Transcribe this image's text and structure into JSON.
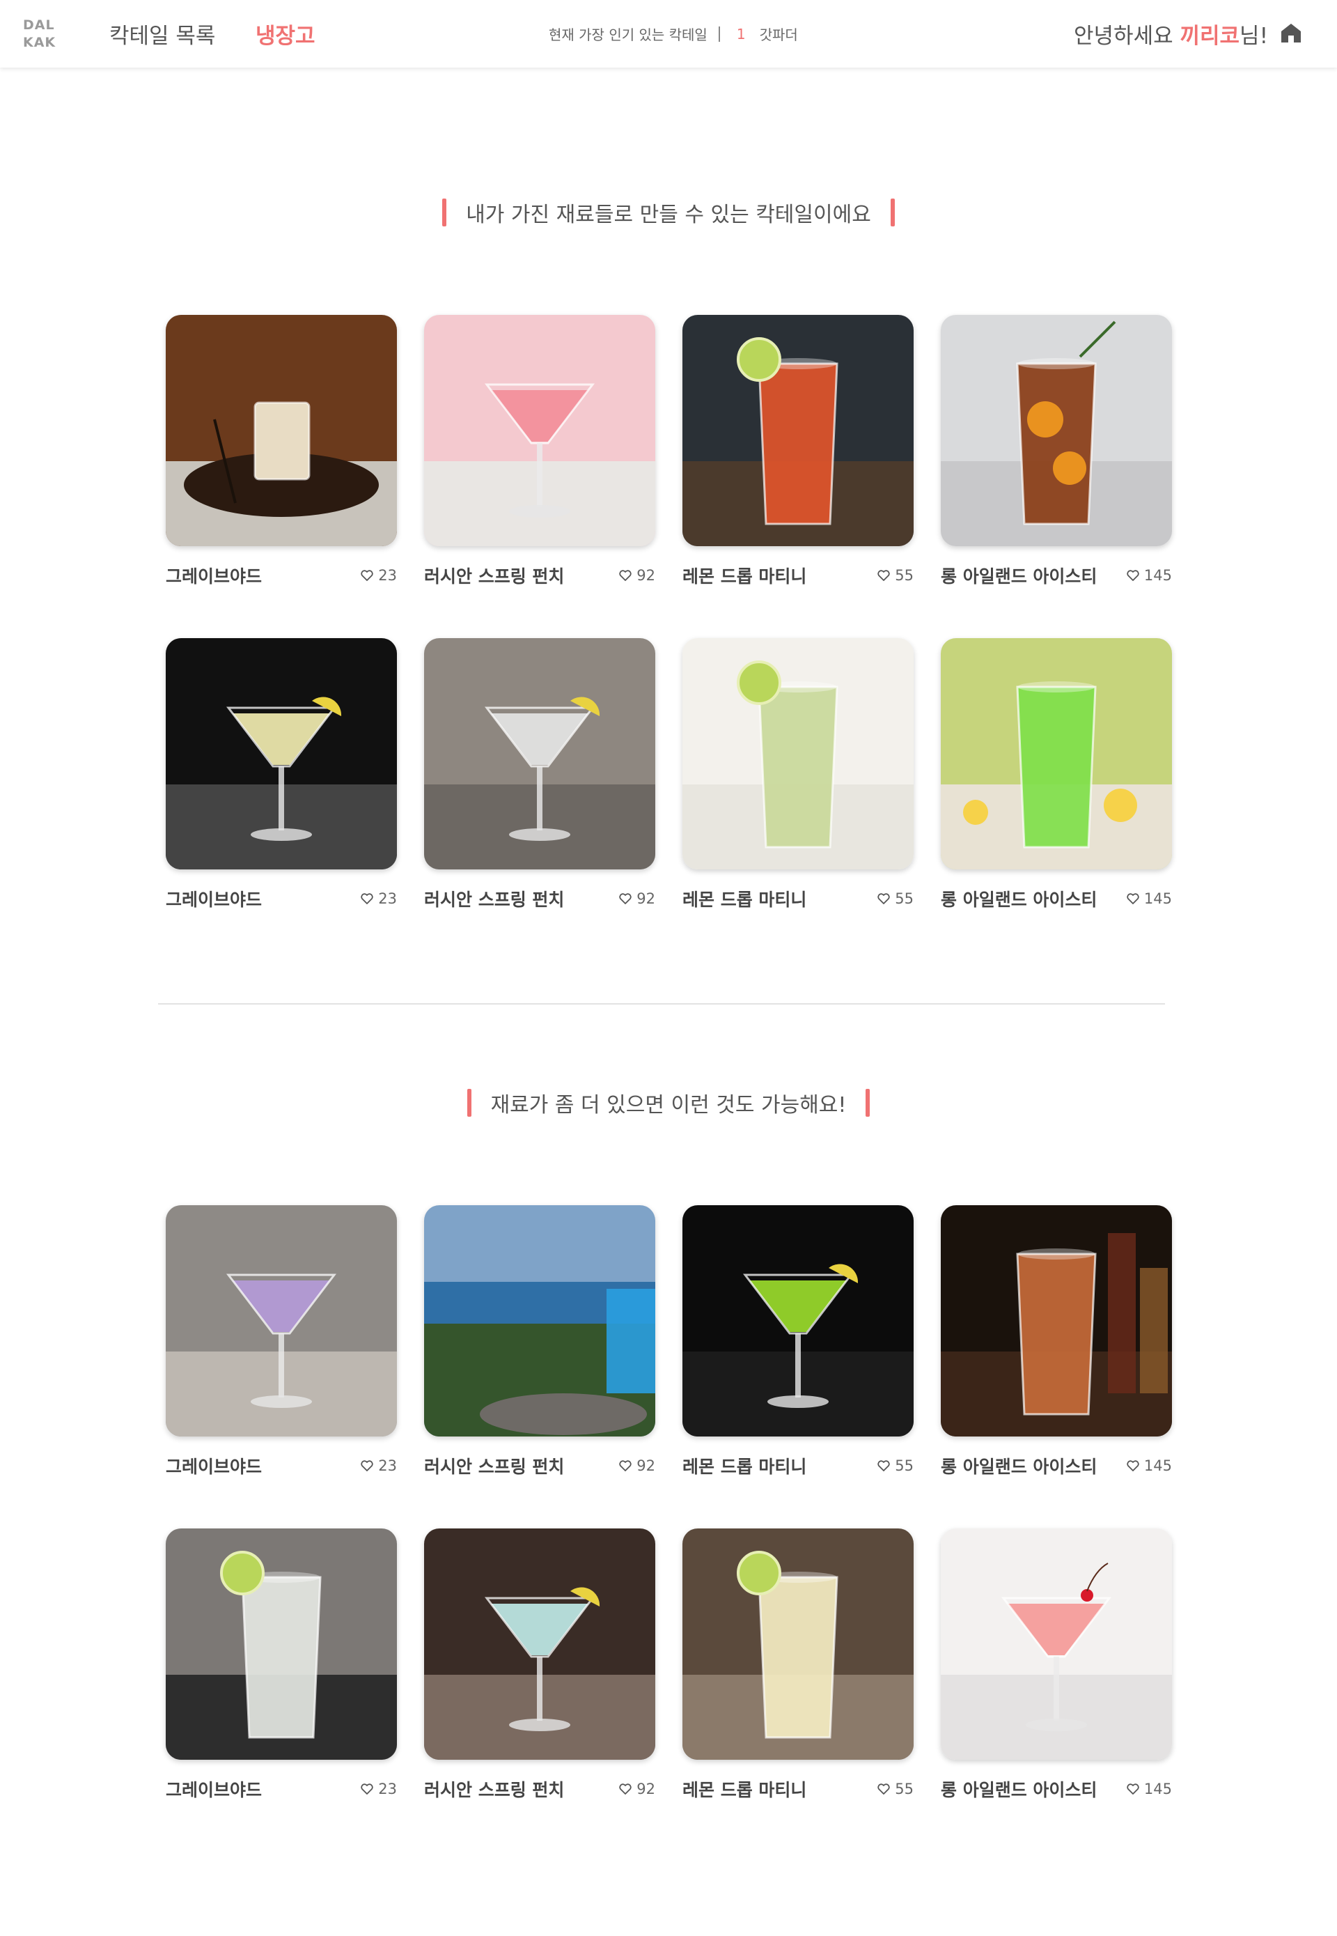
{
  "header": {
    "logo_line1": "DAL",
    "logo_line2": "KAK",
    "nav_cocktail_list": "칵테일 목록",
    "nav_fridge": "냉장고",
    "ticker_label": "현재 가장 인기 있는 칵테일",
    "ticker_rank": "1",
    "ticker_name": "갓파더",
    "greeting_prefix": "안녕하세요 ",
    "user_name": "끼리코",
    "greeting_suffix": "님!",
    "home_icon": "home-icon"
  },
  "section_makeable": {
    "title": "내가 가진 재료들로 만들 수 있는 칵테일이에요",
    "cards": [
      {
        "name": "그레이브야드",
        "likes": "23",
        "theme": "creamy",
        "bg1": "#6b3a1c",
        "bg2": "#c8c3bb",
        "drink": "#e8dcc4"
      },
      {
        "name": "러시안 스프링 펀치",
        "likes": "92",
        "theme": "pink",
        "bg1": "#f4c9cf",
        "bg2": "#e9e6e3",
        "drink": "#f28e9a"
      },
      {
        "name": "레몬 드롭 마티니",
        "likes": "55",
        "theme": "orange",
        "bg1": "#2a3036",
        "bg2": "#4b3a2c",
        "drink": "#e0552b"
      },
      {
        "name": "롱 아일랜드 아이스티",
        "likes": "145",
        "theme": "tea",
        "bg1": "#d9dadc",
        "bg2": "#c8c8ca",
        "drink": "#8a3d16"
      },
      {
        "name": "그레이브야드",
        "likes": "23",
        "theme": "margarita",
        "bg1": "#111111",
        "bg2": "#444444",
        "drink": "#f1ecb0"
      },
      {
        "name": "러시안 스프링 펀치",
        "likes": "92",
        "theme": "martini",
        "bg1": "#8e8780",
        "bg2": "#6d6863",
        "drink": "#e4e4e4"
      },
      {
        "name": "레몬 드롭 마티니",
        "likes": "55",
        "theme": "mojito",
        "bg1": "#f3f1ec",
        "bg2": "#e8e6df",
        "drink": "#c9d99a"
      },
      {
        "name": "롱 아일랜드 아이스티",
        "likes": "145",
        "theme": "green",
        "bg1": "#c6d47c",
        "bg2": "#e8e2d3",
        "drink": "#7fe04a"
      }
    ]
  },
  "section_more": {
    "title": "재료가 좀 더 있으면 이런 것도 가능해요!",
    "cards": [
      {
        "name": "그레이브야드",
        "likes": "23",
        "theme": "violet",
        "bg1": "#8e8a86",
        "bg2": "#bdb7b0",
        "drink": "#b49ad8"
      },
      {
        "name": "러시안 스프링 펀치",
        "likes": "92",
        "theme": "ocean",
        "bg1": "#7fa3c8",
        "bg2": "#2e5a3a",
        "drink": "#2a9fe0"
      },
      {
        "name": "레몬 드롭 마티니",
        "likes": "55",
        "theme": "appletini",
        "bg1": "#0c0c0c",
        "bg2": "#1b1b1b",
        "drink": "#9bdc2c"
      },
      {
        "name": "롱 아일랜드 아이스티",
        "likes": "145",
        "theme": "bar",
        "bg1": "#1a120c",
        "bg2": "#3b2518",
        "drink": "#c66a3a"
      },
      {
        "name": "그레이브야드",
        "likes": "23",
        "theme": "highball",
        "bg1": "#7c7875",
        "bg2": "#2d2d2d",
        "drink": "#e4e7e2"
      },
      {
        "name": "러시안 스프링 펀치",
        "likes": "92",
        "theme": "bluemartini",
        "bg1": "#3a2c26",
        "bg2": "#7b6a60",
        "drink": "#bfe9e6"
      },
      {
        "name": "레몬 드롭 마티니",
        "likes": "55",
        "theme": "pina",
        "bg1": "#5b4a3c",
        "bg2": "#8b7a6a",
        "drink": "#f4ecc2"
      },
      {
        "name": "롱 아일랜드 아이스티",
        "likes": "145",
        "theme": "cosmo",
        "bg1": "#f3f1f0",
        "bg2": "#e4e2e2",
        "drink": "#f59a98"
      }
    ]
  }
}
